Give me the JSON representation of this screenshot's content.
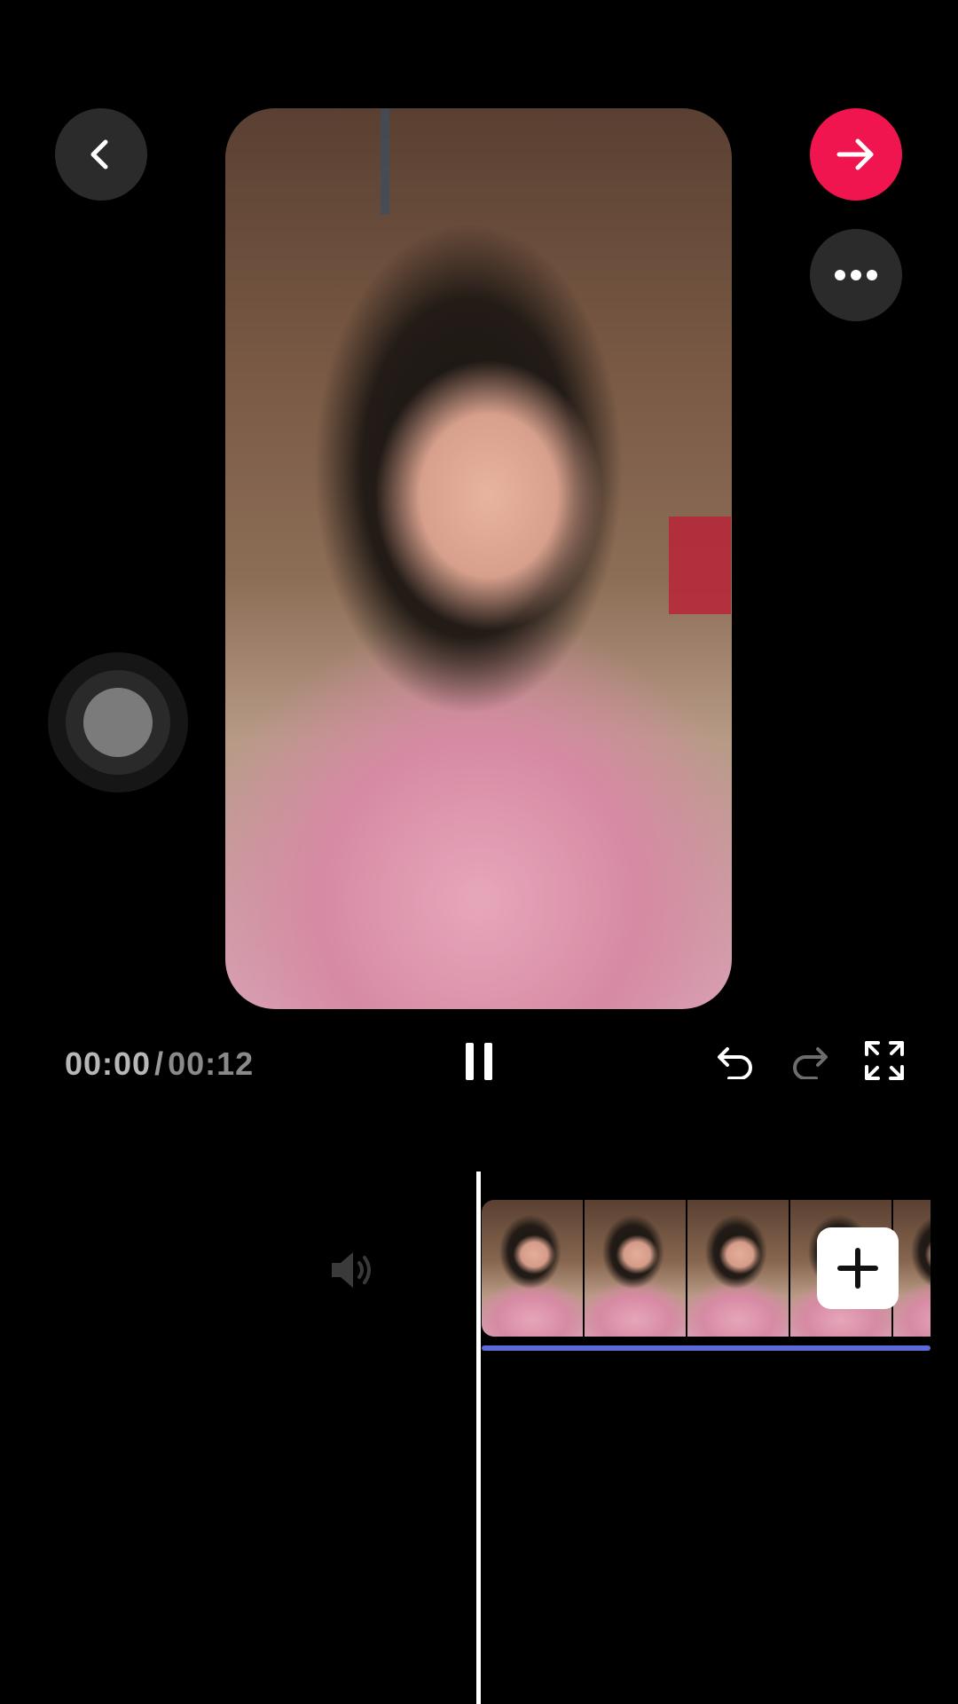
{
  "header": {
    "back_icon": "chevron-left-icon",
    "next_icon": "arrow-right-icon",
    "more_icon": "ellipsis-icon"
  },
  "preview": {
    "content": "video-preview"
  },
  "controls": {
    "current_time": "00:00",
    "separator": "/",
    "total_time": "00:12",
    "pause_icon": "pause-icon",
    "undo_icon": "undo-icon",
    "redo_icon": "redo-icon",
    "fullscreen_icon": "fullscreen-icon"
  },
  "timeline": {
    "audio_icon": "speaker-icon",
    "add_icon": "plus-icon"
  },
  "colors": {
    "accent": "#f0154e",
    "button_bg": "#2b2b2b",
    "timeline_underline": "#5b6ad6"
  }
}
